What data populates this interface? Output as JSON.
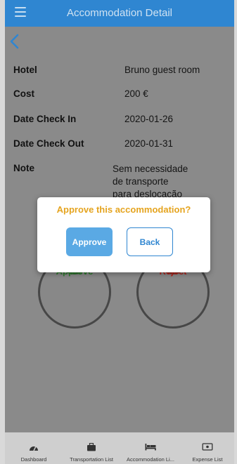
{
  "header": {
    "title": "Accommodation Detail"
  },
  "details": {
    "hotel_label": "Hotel",
    "hotel_value": "Bruno guest room",
    "cost_label": "Cost",
    "cost_value": "200 €",
    "checkin_label": "Date Check In",
    "checkin_value": "2020-01-26",
    "checkout_label": "Date Check Out",
    "checkout_value": "2020-01-31",
    "note_label": "Note",
    "note_lines": [
      "Sem necessidade",
      "de transporte",
      "para deslocação"
    ]
  },
  "actions": {
    "approve_label": "Approve",
    "reject_label": "Reject"
  },
  "dialog": {
    "question": "Approve this accommodation?",
    "approve_label": "Approve",
    "back_label": "Back"
  },
  "tabs": [
    {
      "label": "Dashboard",
      "icon": "dashboard-icon"
    },
    {
      "label": "Transportation List",
      "icon": "briefcase-icon"
    },
    {
      "label": "Accommodation Li...",
      "icon": "bed-icon"
    },
    {
      "label": "Expense List",
      "icon": "money-icon"
    }
  ],
  "colors": {
    "primary": "#2f86d1",
    "accent": "#e5a41f",
    "approve_green": "#3a8a3a",
    "reject_red": "#c0392b"
  }
}
